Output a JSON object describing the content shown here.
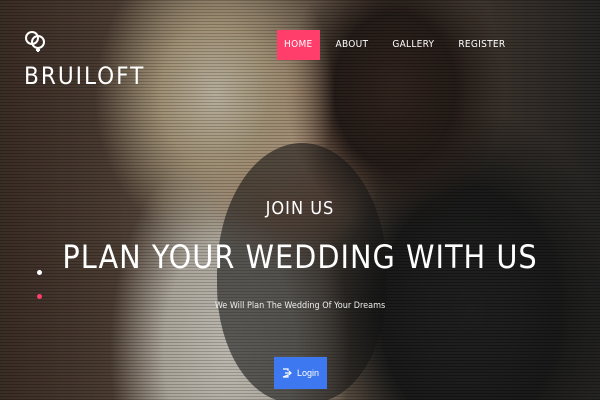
{
  "brand": {
    "name": "BRUILOFT",
    "icon": "rings-icon"
  },
  "nav": {
    "items": [
      {
        "label": "HOME",
        "active": true
      },
      {
        "label": "ABOUT",
        "active": false
      },
      {
        "label": "GALLERY",
        "active": false
      },
      {
        "label": "REGISTER",
        "active": false
      }
    ]
  },
  "hero": {
    "kicker": "JOIN US",
    "headline": "PLAN YOUR WEDDING WITH US",
    "subtitle": "We Will Plan The Wedding Of Your Dreams",
    "login_label": "Login",
    "login_icon": "sign-in-icon"
  },
  "slider": {
    "dots": [
      "white",
      "pink"
    ]
  },
  "colors": {
    "accent": "#ff3e6c",
    "button": "#3d78f0"
  }
}
